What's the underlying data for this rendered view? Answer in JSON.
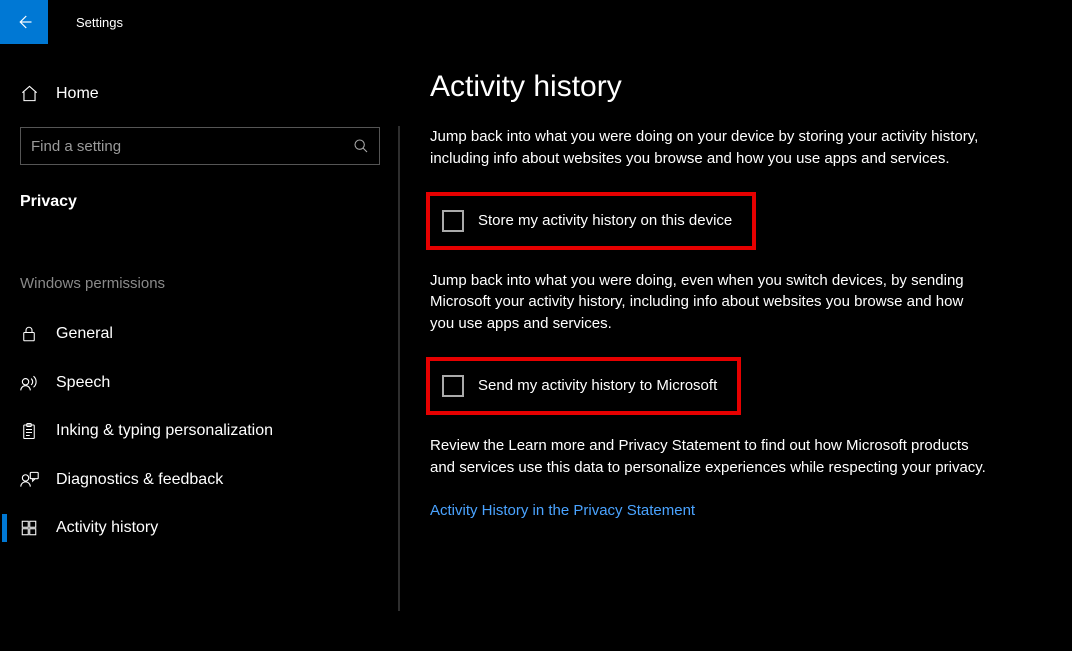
{
  "app": {
    "title": "Settings"
  },
  "sidebar": {
    "home": "Home",
    "search_placeholder": "Find a setting",
    "current_section": "Privacy",
    "group_label": "Windows permissions",
    "items": [
      {
        "label": "General"
      },
      {
        "label": "Speech"
      },
      {
        "label": "Inking & typing personalization"
      },
      {
        "label": "Diagnostics & feedback"
      },
      {
        "label": "Activity history"
      }
    ]
  },
  "content": {
    "heading": "Activity history",
    "para1": "Jump back into what you were doing on your device by storing your activity history, including info about websites you browse and how you use apps and services.",
    "check1": "Store my activity history on this device",
    "para2": "Jump back into what you were doing, even when you switch devices, by sending Microsoft your activity history, including info about websites you browse and how you use apps and services.",
    "check2": "Send my activity history to Microsoft",
    "para3": "Review the Learn more and Privacy Statement to find out how Microsoft products and services use this data to personalize experiences while respecting your privacy.",
    "link": "Activity History in the Privacy Statement"
  }
}
